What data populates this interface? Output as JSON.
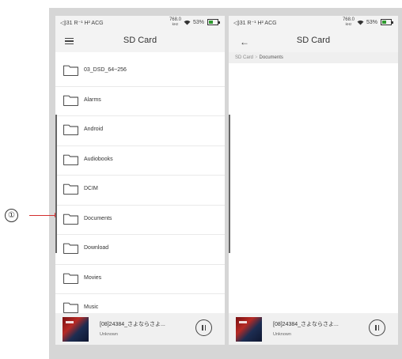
{
  "status_bar": {
    "left_text": "◁)31 R⁻¹ H² ACG",
    "rate_value": "768.0",
    "rate_unit": "kHz",
    "battery_percent": "53%",
    "icons": [
      "volume-icon",
      "wifi-icon",
      "battery-icon"
    ]
  },
  "left_screen": {
    "title": "SD Card",
    "menu_icon": "hamburger-menu-icon",
    "folders": [
      {
        "label": "03_DSD_64~256"
      },
      {
        "label": "Alarms"
      },
      {
        "label": "Android"
      },
      {
        "label": "Audiobooks"
      },
      {
        "label": "DCIM"
      },
      {
        "label": "Documents"
      },
      {
        "label": "Download"
      },
      {
        "label": "Movies"
      },
      {
        "label": "Music"
      }
    ]
  },
  "right_screen": {
    "title": "SD Card",
    "back_icon": "back-arrow-icon",
    "breadcrumb": {
      "root": "SD Card",
      "separator": ">",
      "current": "Documents"
    }
  },
  "player": {
    "track": "[08]24384_さよならさよ...",
    "artist": "Unknown",
    "control_icon": "pause-icon"
  },
  "callout": {
    "number": "①",
    "arrow_color": "#d32f2f"
  },
  "colors": {
    "bar_background": "#f3f3f3",
    "battery_fill": "#2e9a2e",
    "frame": "#d6d6d6"
  }
}
